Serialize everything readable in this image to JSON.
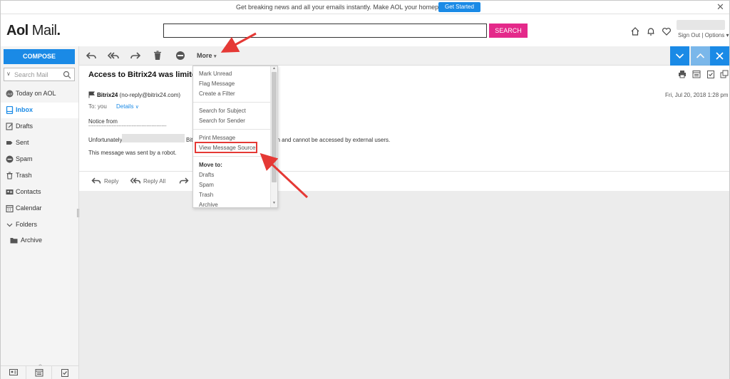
{
  "banner": {
    "text": "Get breaking news and all your emails instantly. Make AOL your homepage now.",
    "button": "Get Started",
    "close": "✕"
  },
  "header": {
    "logo_brand": "Aol",
    "logo_product": "Mail",
    "logo_dot": ".",
    "search_placeholder": "",
    "search_button": "SEARCH",
    "sign_out": "Sign Out",
    "separator": "|",
    "options": "Options"
  },
  "sidebar": {
    "compose": "COMPOSE",
    "search_placeholder": "Search Mail",
    "items": [
      {
        "label": "Today on AOL",
        "icon": "aol-icon"
      },
      {
        "label": "Inbox",
        "icon": "inbox-icon"
      },
      {
        "label": "Drafts",
        "icon": "drafts-icon"
      },
      {
        "label": "Sent",
        "icon": "sent-icon"
      },
      {
        "label": "Spam",
        "icon": "spam-icon"
      },
      {
        "label": "Trash",
        "icon": "trash-icon"
      },
      {
        "label": "Contacts",
        "icon": "contacts-icon"
      },
      {
        "label": "Calendar",
        "icon": "calendar-icon"
      },
      {
        "label": "Folders",
        "icon": "chevron-down-icon"
      },
      {
        "label": "Archive",
        "icon": "folder-icon"
      }
    ],
    "active_item": "Inbox"
  },
  "toolbar": {
    "more": "More",
    "more_caret": "▾"
  },
  "message": {
    "subject": "Access to Bitrix24 was limited.",
    "sender_name": "Bitrix24",
    "sender_email": "(no-reply@bitrix24.com)",
    "to_label": "To: you",
    "details": "Details",
    "date": "Fri, Jul 20, 2018 1:28 pm",
    "body": {
      "notice": "Notice from",
      "rule": "-----------------------------------------------",
      "line_start": "Unfortunately",
      "line_mid": "Bit",
      "line_end": "an and cannot be accessed by external users.",
      "robot": "This message was sent by a robot."
    },
    "reply": "Reply",
    "reply_all": "Reply All"
  },
  "dropdown": {
    "items": [
      "Mark Unread",
      "Flag Message",
      "Create a Filter",
      "Search for Subject",
      "Search for Sender",
      "Print Message",
      "View Message Source",
      "Move to:",
      "Drafts",
      "Spam",
      "Trash",
      "Archive"
    ],
    "highlighted": "View Message Source"
  },
  "colors": {
    "accent": "#1a8ae6",
    "search_button": "#e4298a",
    "annotation": "#e53935"
  }
}
